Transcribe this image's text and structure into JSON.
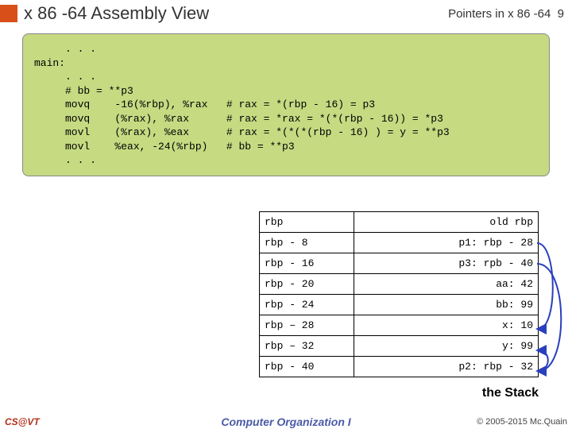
{
  "header": {
    "title": "x 86 -64 Assembly View",
    "slide_label": "Pointers in x 86 -64",
    "slide_num": "9"
  },
  "code_block": "     . . .\nmain:\n     . . .\n     # bb = **p3\n     movq    -16(%rbp), %rax   # rax = *(rbp - 16) = p3\n     movq    (%rax), %rax      # rax = *rax = *(*(rbp - 16)) = *p3\n     movl    (%rax), %eax      # rax = *(*(*(rbp - 16) ) = y = **p3\n     movl    %eax, -24(%rbp)   # bb = **p3\n     . . .",
  "stack": {
    "rows": [
      {
        "addr": "rbp",
        "val": "old rbp"
      },
      {
        "addr": "rbp -  8",
        "val": "p1: rbp - 28"
      },
      {
        "addr": "rbp - 16",
        "val": "p3: rpb - 40"
      },
      {
        "addr": "rbp - 20",
        "val": "aa:  42"
      },
      {
        "addr": "rbp - 24",
        "val": "bb:  99"
      },
      {
        "addr": "rbp – 28",
        "val": "x:  10"
      },
      {
        "addr": "rbp – 32",
        "val": "y:  99"
      },
      {
        "addr": "rbp - 40",
        "val": "p2: rbp - 32"
      }
    ],
    "caption": "the Stack"
  },
  "footer": {
    "left": "CS@VT",
    "mid": "Computer Organization I",
    "right": "© 2005-2015 Mc.Quain"
  }
}
